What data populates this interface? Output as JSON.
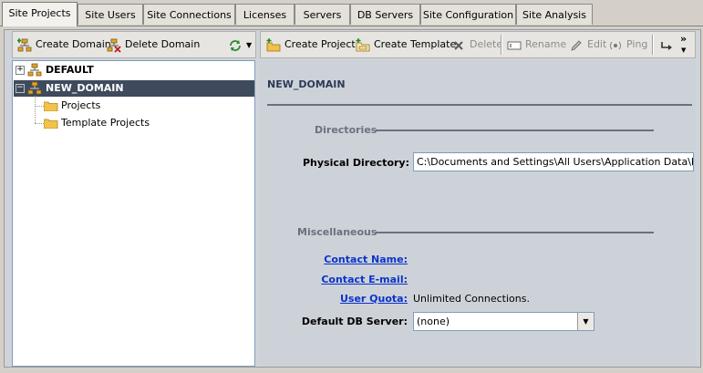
{
  "tabs": [
    {
      "label": "Site Projects",
      "active": true
    },
    {
      "label": "Site Users"
    },
    {
      "label": "Site Connections"
    },
    {
      "label": "Licenses"
    },
    {
      "label": "Servers"
    },
    {
      "label": "DB Servers"
    },
    {
      "label": "Site Configuration"
    },
    {
      "label": "Site Analysis"
    }
  ],
  "left_toolbar": {
    "create_domain": "Create Domain",
    "delete_domain": "Delete Domain"
  },
  "right_toolbar": {
    "create_project": "Create Project",
    "create_template": "Create Template",
    "delete": "Delete",
    "rename": "Rename",
    "edit": "Edit",
    "ping": "Ping",
    "more": "»"
  },
  "tree": {
    "domain_default": "DEFAULT",
    "domain_new": "NEW_DOMAIN",
    "projects": "Projects",
    "template_projects": "Template Projects",
    "expand_sign": "+",
    "collapse_sign": "−"
  },
  "details": {
    "title": "NEW_DOMAIN",
    "directories_section": "Directories",
    "physical_directory_label": "Physical Directory:",
    "physical_directory_value": "C:\\Documents and Settings\\All Users\\Application Data\\HP\\ALM\\",
    "misc_section": "Miscellaneous",
    "contact_name_label": "Contact Name:",
    "contact_email_label": "Contact E-mail:",
    "user_quota_label": "User Quota:",
    "user_quota_value": "Unlimited Connections.",
    "default_db_label": "Default DB Server:",
    "default_db_value": "(none)"
  },
  "colors": {
    "link": "#0a33cc",
    "selection": "#3f4a5c",
    "section": "#6a7180"
  }
}
